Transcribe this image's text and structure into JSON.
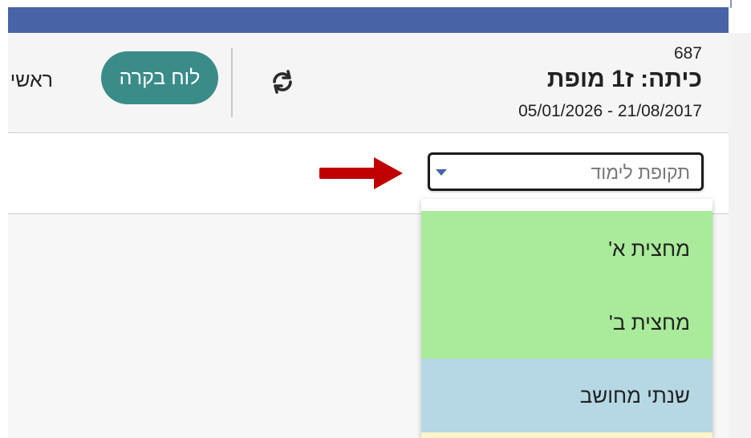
{
  "header": {
    "class_id": "687",
    "class_title": "כיתה: ז1 מופת",
    "date_range": "05/01/2026 - 21/08/2017",
    "board_button_label": "לוח בקרה",
    "partial_text": "ראשי"
  },
  "filter": {
    "select_placeholder": "תקופת לימוד",
    "options": [
      {
        "label": "מחצית א'",
        "color": "#a9eb9a"
      },
      {
        "label": "מחצית ב'",
        "color": "#a9eb9a"
      },
      {
        "label": "שנתי מחושב",
        "color": "#b6d8e5"
      },
      {
        "label": "",
        "color": "#fff5c8"
      }
    ]
  },
  "annotation": {
    "arrow_color": "#c00000"
  },
  "colors": {
    "topbar": "#4864a6",
    "button": "#3a8c89"
  },
  "icons": {
    "refresh": "refresh-icon"
  }
}
